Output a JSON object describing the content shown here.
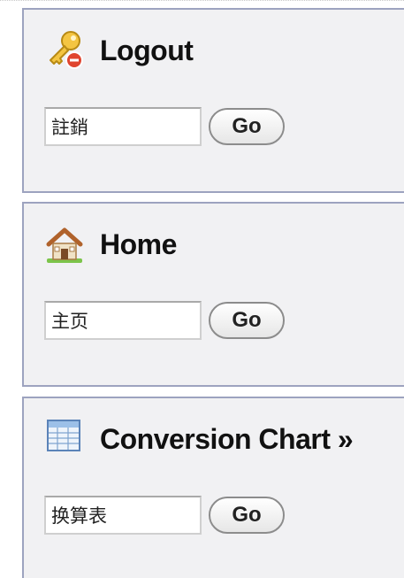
{
  "panels": [
    {
      "title": "Logout",
      "icon": "key-remove-icon",
      "input_value": "註銷",
      "button_label": "Go"
    },
    {
      "title": "Home",
      "icon": "house-icon",
      "input_value": "主页",
      "button_label": "Go"
    },
    {
      "title": "Conversion Chart »",
      "icon": "spreadsheet-icon",
      "input_value": "换算表",
      "button_label": "Go"
    }
  ],
  "colors": {
    "panel_background": "#f1f1f3",
    "panel_border": "#9da3bf",
    "title_text": "#111111"
  }
}
